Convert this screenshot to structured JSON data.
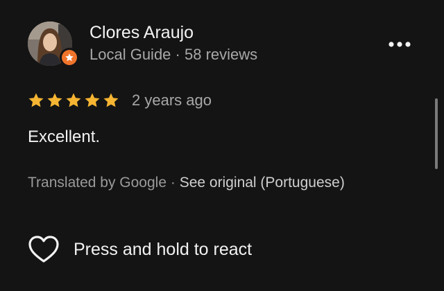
{
  "review": {
    "author_name": "Clores Araujo",
    "author_level": "Local Guide",
    "author_reviews": "58 reviews",
    "meta_separator": " · ",
    "rating": 5,
    "rating_max": 5,
    "date": "2 years ago",
    "text": "Excellent.",
    "translated_by": "Translated by Google",
    "see_original": "See original (Portuguese)",
    "react_label": "Press and hold to react"
  },
  "icons": {
    "avatar": "avatar-photo",
    "badge": "local-guide-star-icon",
    "more": "more-horizontal-icon",
    "star": "star-icon",
    "react": "heart-outline-icon"
  },
  "colors": {
    "background": "#141414",
    "star": "#f6b532",
    "badge": "#f0742b",
    "text_primary": "#f2f2f2",
    "text_secondary": "#a8a8a8"
  }
}
